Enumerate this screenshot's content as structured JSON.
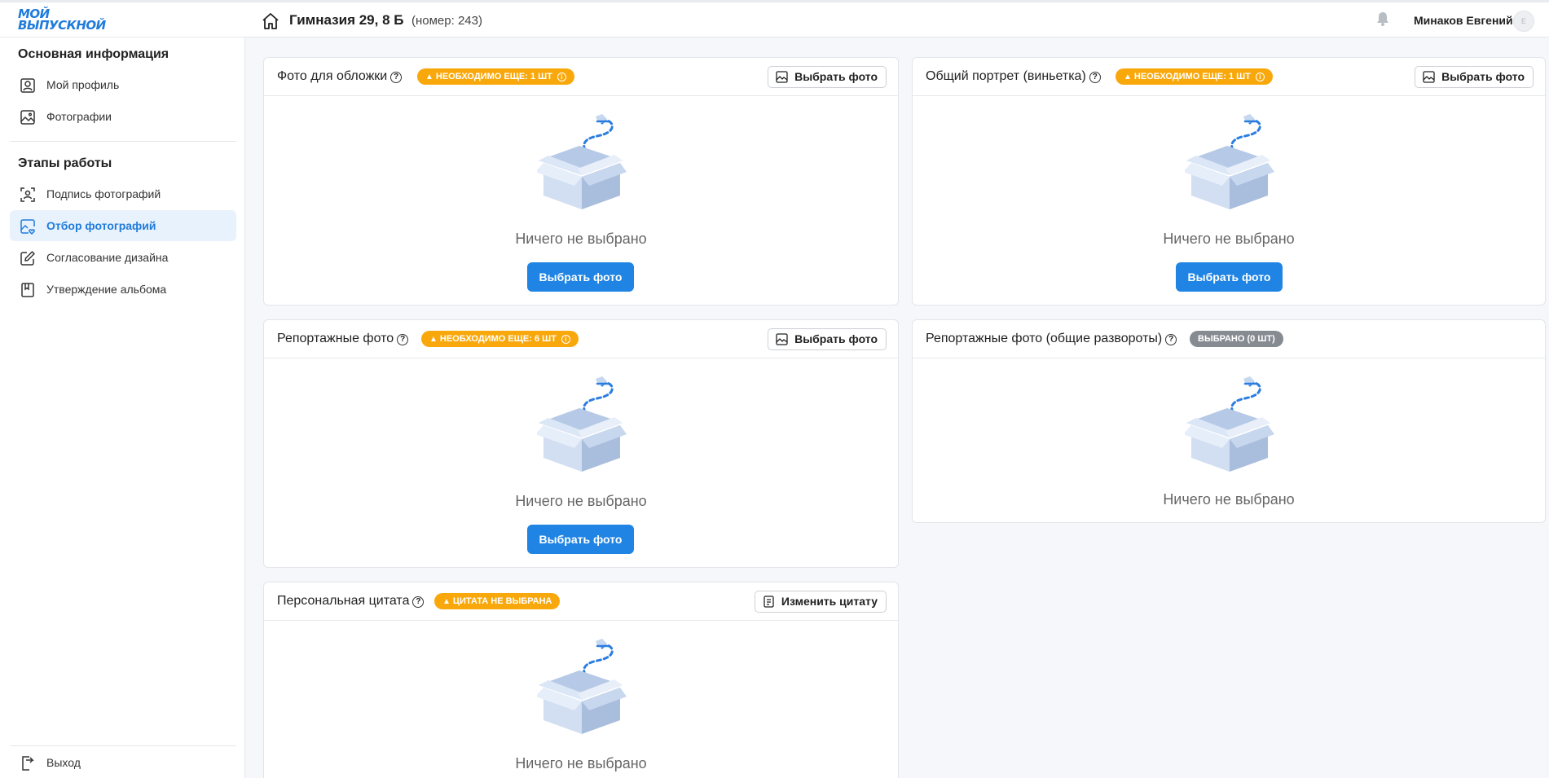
{
  "header": {
    "logo_line1": "МОЙ",
    "logo_line2": "ВЫПУСКНОЙ",
    "school": "Гимназия 29, 8 Б",
    "school_number": "(номер: 243)",
    "user_name": "Минаков Евгений",
    "avatar_initial": "E"
  },
  "sidebar": {
    "section_main": "Основная информация",
    "section_stages": "Этапы работы",
    "items": [
      {
        "label": "Мой профиль",
        "icon": "profile-icon"
      },
      {
        "label": "Фотографии",
        "icon": "image-icon"
      },
      {
        "label": "Подпись фотографий",
        "icon": "face-scan-icon"
      },
      {
        "label": "Отбор фотографий",
        "icon": "image-heart-icon",
        "active": true
      },
      {
        "label": "Согласование дизайна",
        "icon": "edit-icon"
      },
      {
        "label": "Утверждение альбома",
        "icon": "album-icon"
      }
    ],
    "logout": "Выход"
  },
  "cards": [
    {
      "title": "Фото для обложки",
      "badge": "НЕОБХОДИМО ЕЩЕ: 1 ШТ",
      "badge_color": "#f9a80c",
      "action": "Выбрать фото",
      "empty": "Ничего не выбрано",
      "primary": "Выбрать фото"
    },
    {
      "title": "Общий портрет (виньетка)",
      "badge": "НЕОБХОДИМО ЕЩЕ: 1 ШТ",
      "badge_color": "#f9a80c",
      "action": "Выбрать фото",
      "empty": "Ничего не выбрано",
      "primary": "Выбрать фото"
    },
    {
      "title": "Репортажные фото",
      "badge": "НЕОБХОДИМО ЕЩЕ: 6 ШТ",
      "badge_color": "#f9a80c",
      "action": "Выбрать фото",
      "empty": "Ничего не выбрано",
      "primary": "Выбрать фото"
    },
    {
      "title": "Репортажные фото (общие развороты)",
      "badge": "ВЫБРАНО (0 ШТ)",
      "badge_color": "#868b92",
      "empty": "Ничего не выбрано"
    },
    {
      "title": "Персональная цитата",
      "badge": "ЦИТАТА НЕ ВЫБРАНА",
      "badge_color": "#f9a80c",
      "action": "Изменить цитату",
      "empty": "Ничего не выбрано"
    }
  ],
  "colors": {
    "accent": "#1f84e3",
    "warning": "#f9a80c",
    "neutral": "#868b92"
  }
}
